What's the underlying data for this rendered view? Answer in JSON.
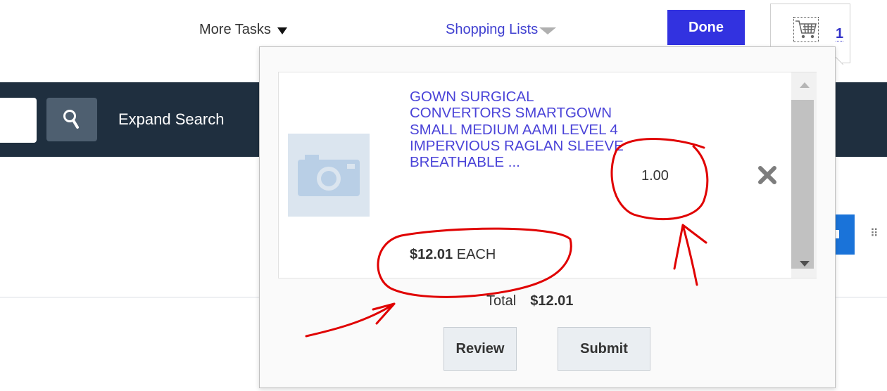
{
  "header": {
    "more_tasks": "More Tasks",
    "shopping_lists": "Shopping Lists",
    "done": "Done",
    "cart_count": "1"
  },
  "search": {
    "expand_label": "Expand Search",
    "input_value": ""
  },
  "cart_popup": {
    "item": {
      "name": "GOWN SURGICAL CONVERTORS SMARTGOWN SMALL MEDIUM AAMI LEVEL 4 IMPERVIOUS RAGLAN SLEEVE BREATHABLE ...",
      "price": "$12.01",
      "unit": "EACH",
      "quantity": "1.00"
    },
    "total_label": "Total",
    "total_value": "$12.01",
    "review_label": "Review",
    "submit_label": "Submit"
  },
  "icons": {
    "search": "search-icon",
    "cart": "shopping-cart-icon",
    "camera": "camera-placeholder-icon",
    "remove": "close-icon"
  },
  "colors": {
    "link": "#4a43d8",
    "done_button": "#3232e0",
    "search_bar": "#1f2f3f",
    "annotation": "#e00000"
  }
}
